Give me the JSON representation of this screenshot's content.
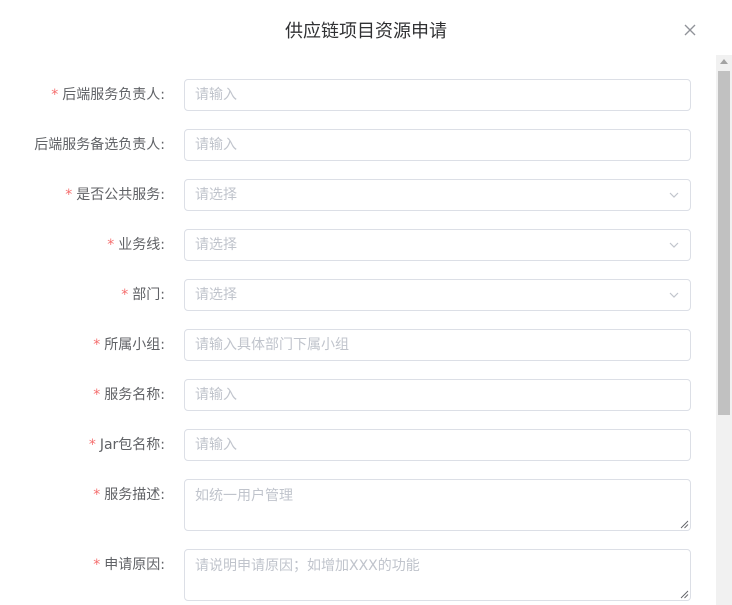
{
  "dialog": {
    "title": "供应链项目资源申请",
    "close_icon": "close-icon"
  },
  "form": {
    "fields": [
      {
        "key": "backend_owner",
        "label": "后端服务负责人:",
        "required": true,
        "type": "input",
        "placeholder": "请输入"
      },
      {
        "key": "backend_backup_owner",
        "label": "后端服务备选负责人:",
        "required": false,
        "type": "input",
        "placeholder": "请输入"
      },
      {
        "key": "is_public_service",
        "label": "是否公共服务:",
        "required": true,
        "type": "select",
        "placeholder": "请选择"
      },
      {
        "key": "business_line",
        "label": "业务线:",
        "required": true,
        "type": "select",
        "placeholder": "请选择"
      },
      {
        "key": "department",
        "label": "部门:",
        "required": true,
        "type": "select",
        "placeholder": "请选择"
      },
      {
        "key": "team",
        "label": "所属小组:",
        "required": true,
        "type": "input",
        "placeholder": "请输入具体部门下属小组"
      },
      {
        "key": "service_name",
        "label": "服务名称:",
        "required": true,
        "type": "input",
        "placeholder": "请输入"
      },
      {
        "key": "jar_name",
        "label": "Jar包名称:",
        "required": true,
        "type": "input",
        "placeholder": "请输入"
      },
      {
        "key": "service_desc",
        "label": "服务描述:",
        "required": true,
        "type": "textarea",
        "placeholder": "如统一用户管理"
      },
      {
        "key": "apply_reason",
        "label": "申请原因:",
        "required": true,
        "type": "textarea",
        "placeholder": "请说明申请原因；如增加XXX的功能"
      }
    ],
    "required_marker": "*"
  },
  "colors": {
    "required": "#f56c6c",
    "border": "#dcdfe6",
    "placeholder": "#c0c4cc",
    "label": "#606266",
    "title": "#303133"
  }
}
